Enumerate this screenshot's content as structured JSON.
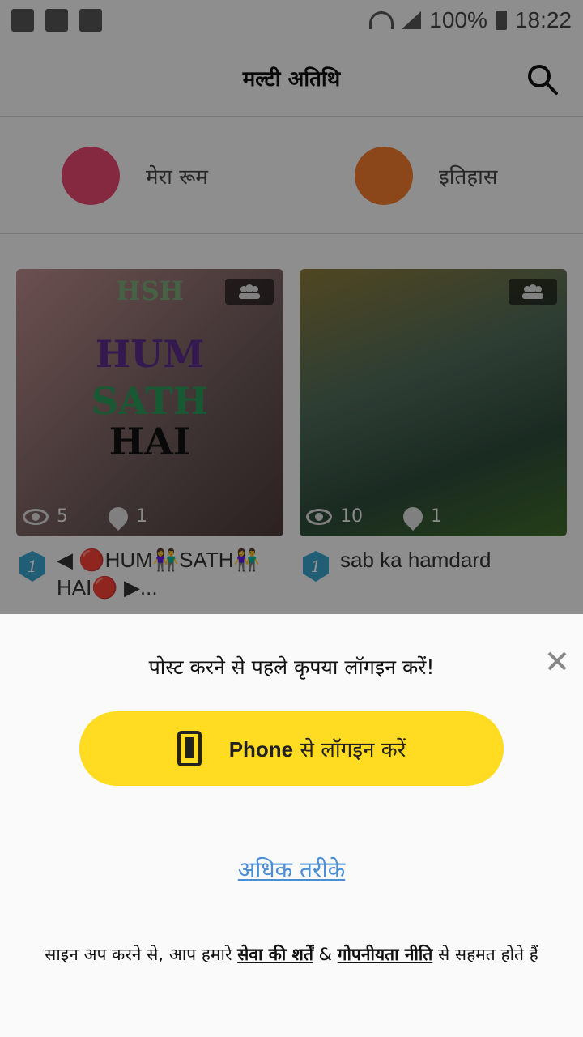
{
  "status": {
    "battery": "100%",
    "time": "18:22"
  },
  "header": {
    "title": "मल्टी अतिथि"
  },
  "shortcuts": [
    {
      "label": "मेरा रूम",
      "color": "#e6476e"
    },
    {
      "label": "इतिहास",
      "color": "#f07a2b"
    }
  ],
  "cards": [
    {
      "views": "5",
      "speakers": "1",
      "caption": "◀ 🔴HUM👫SATH👫 HAI🔴 ▶...",
      "image_text": [
        "HSH",
        "HUM",
        "SATH",
        "HAI"
      ]
    },
    {
      "views": "10",
      "speakers": "1",
      "caption": "sab ka hamdard"
    }
  ],
  "sheet": {
    "prompt": "पोस्ट करने से पहले कृपया लॉगइन करें!",
    "phone_bold": "Phone",
    "phone_rest": " से लॉगइन करें",
    "more": "अधिक तरीके",
    "terms_prefix": "साइन अप करने से, आप हमारे ",
    "terms_link1": "सेवा की शर्तें",
    "terms_amp": " & ",
    "terms_link2": "गोपनीयता नीति",
    "terms_suffix": " से सहमत होते हैं"
  }
}
